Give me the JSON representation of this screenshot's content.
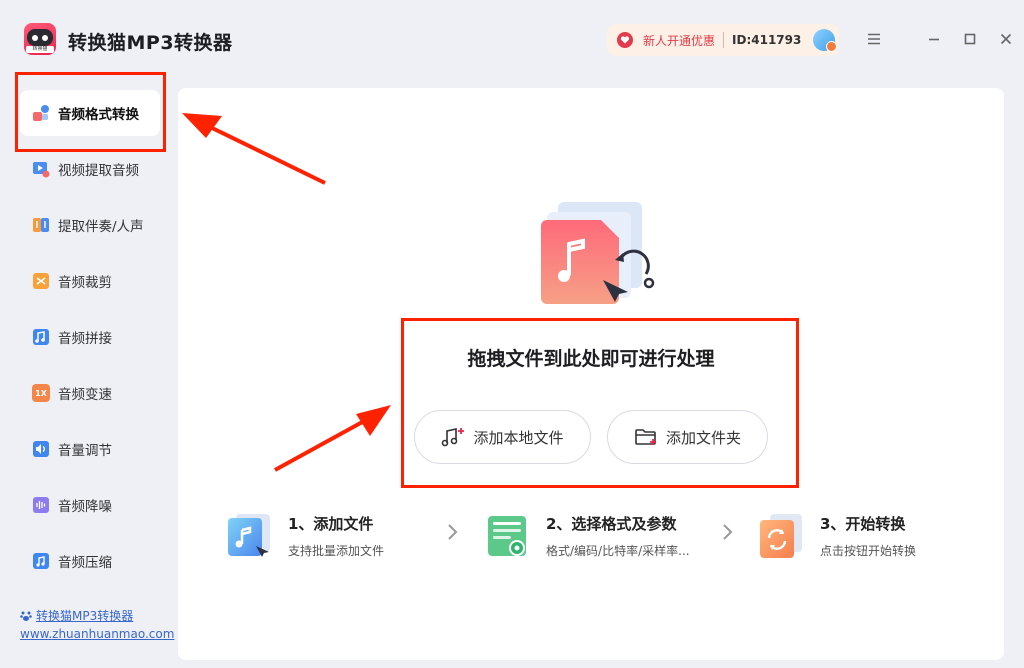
{
  "app": {
    "title": "转换猫MP3转换器",
    "logo_text": "转换猫"
  },
  "header": {
    "promo_text": "新人开通优惠",
    "user_id": "ID:411793"
  },
  "sidebar": {
    "items": [
      {
        "label": "音频格式转换",
        "icon": "audio-convert-icon",
        "active": true
      },
      {
        "label": "视频提取音频",
        "icon": "video-extract-icon"
      },
      {
        "label": "提取伴奏/人声",
        "icon": "vocal-extract-icon"
      },
      {
        "label": "音频裁剪",
        "icon": "audio-cut-icon"
      },
      {
        "label": "音频拼接",
        "icon": "audio-merge-icon"
      },
      {
        "label": "音频变速",
        "icon": "audio-speed-icon",
        "badge": "1X"
      },
      {
        "label": "音量调节",
        "icon": "volume-icon"
      },
      {
        "label": "音频降噪",
        "icon": "denoise-icon"
      },
      {
        "label": "音频压缩",
        "icon": "compress-icon"
      }
    ],
    "footer_link": "转换猫MP3转换器",
    "footer_url": "www.zhuanhuanmao.com"
  },
  "main": {
    "drop_title": "拖拽文件到此处即可进行处理",
    "add_file_label": "添加本地文件",
    "add_folder_label": "添加文件夹",
    "steps": [
      {
        "title": "1、添加文件",
        "desc": "支持批量添加文件"
      },
      {
        "title": "2、选择格式及参数",
        "desc": "格式/编码/比特率/采样率..."
      },
      {
        "title": "3、开始转换",
        "desc": "点击按钮开始转换"
      }
    ]
  },
  "colors": {
    "accent_red": "#e8244c",
    "annotation": "#ff2200",
    "link": "#3967c9"
  }
}
